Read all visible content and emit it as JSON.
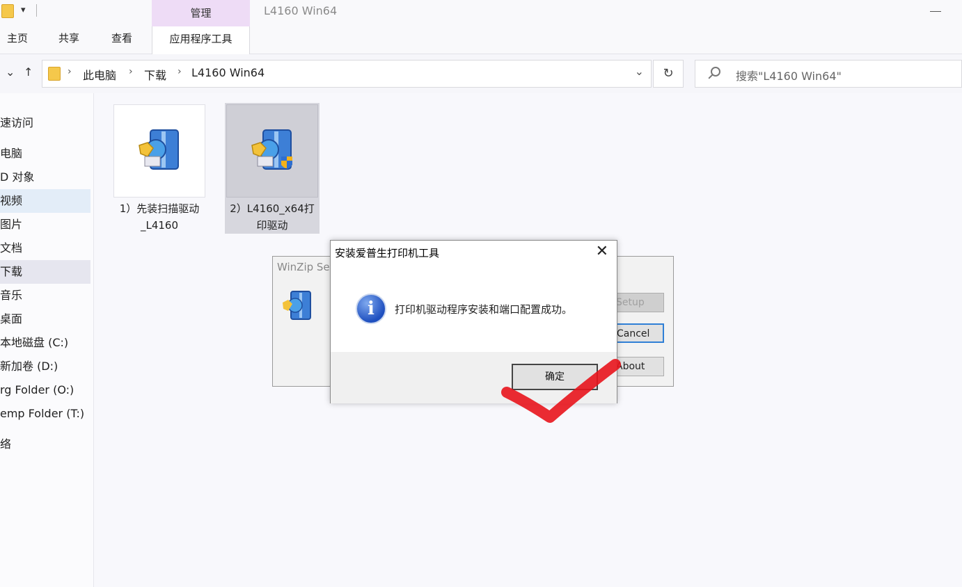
{
  "window": {
    "title": "L4160 Win64",
    "context_tab": "管理"
  },
  "ribbon": {
    "tabs": [
      "主页",
      "共享",
      "查看"
    ],
    "active_tab": "应用程序工具"
  },
  "address": {
    "crumbs": [
      "此电脑",
      "下载",
      "L4160 Win64"
    ],
    "search_placeholder": "搜索\"L4160 Win64\""
  },
  "sidebar": {
    "items": [
      "速访问",
      "电脑",
      "D 对象",
      "视频",
      "图片",
      "文档",
      "下载",
      "音乐",
      "桌面",
      "本地磁盘 (C:)",
      "新加卷 (D:)",
      "rg Folder (O:)",
      "emp Folder (T:)",
      "络"
    ]
  },
  "files": [
    {
      "label_line1": "1）先装扫描驱动",
      "label_line2": "_L4160"
    },
    {
      "label_line1": "2）L4160_x64打",
      "label_line2": "印驱动"
    }
  ],
  "winzip": {
    "title": "WinZip Se",
    "buttons": [
      "Setup",
      "Cancel",
      "About"
    ]
  },
  "msgbox": {
    "title": "安装爱普生打印机工具",
    "message": "打印机驱动程序安装和端口配置成功。",
    "ok_label": "确定",
    "close_glyph": "✕",
    "info_glyph": "i"
  },
  "icons": {
    "qa_dropdown": "▾",
    "back": "←",
    "forward": "→",
    "recent": "⌄",
    "up": "↑",
    "chevron": "›",
    "addr_dropdown": "⌄",
    "refresh": "↻"
  },
  "colors": {
    "context_tab": "#eedcf6",
    "checkmark": "#e8141c",
    "selection": "#d7d7de"
  }
}
